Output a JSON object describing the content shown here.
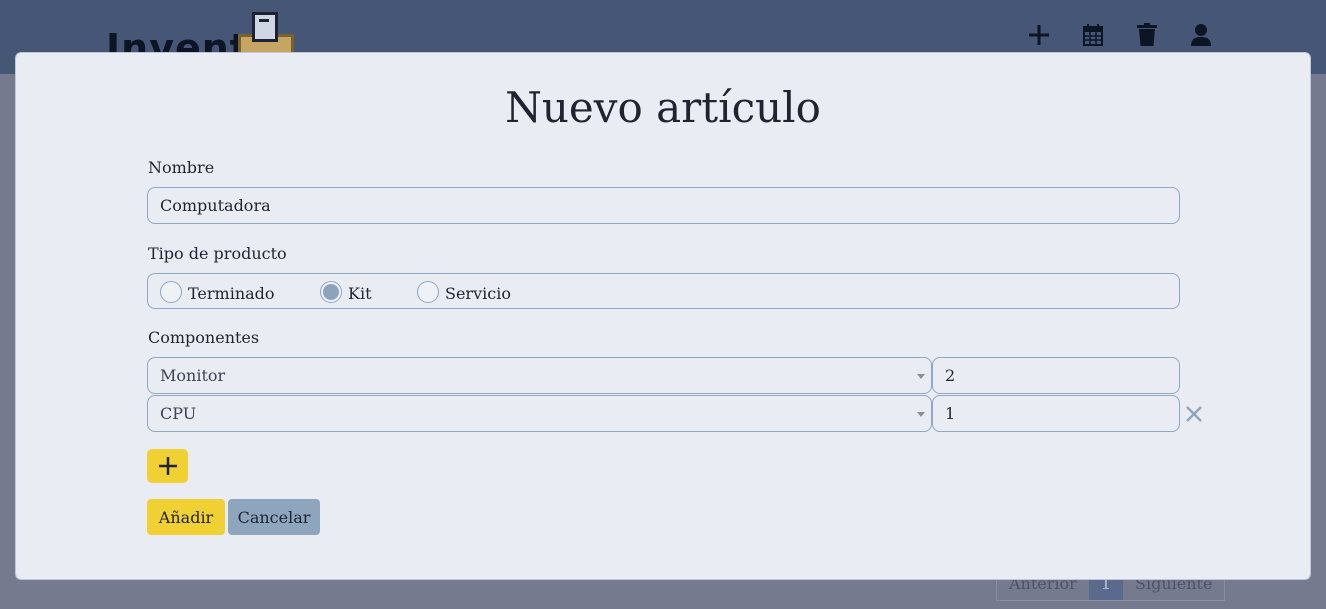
{
  "header": {
    "logo_text": "Invent",
    "icons": [
      "plus-icon",
      "calendar-icon",
      "trash-icon",
      "user-icon"
    ]
  },
  "pagination": {
    "prev": "Anterior",
    "current": "1",
    "next": "Siguiente"
  },
  "modal": {
    "title": "Nuevo artículo",
    "name_label": "Nombre",
    "name_value": "Computadora",
    "type_label": "Tipo de producto",
    "type_options": [
      {
        "label": "Terminado",
        "checked": false
      },
      {
        "label": "Kit",
        "checked": true
      },
      {
        "label": "Servicio",
        "checked": false
      }
    ],
    "components_label": "Componentes",
    "components": [
      {
        "item": "Monitor",
        "qty": "2"
      },
      {
        "item": "CPU",
        "qty": "1"
      }
    ],
    "add_label": "Añadir",
    "cancel_label": "Cancelar"
  },
  "colors": {
    "primary": "#f0d032",
    "secondary": "#8ea5be",
    "header": "#465676"
  }
}
